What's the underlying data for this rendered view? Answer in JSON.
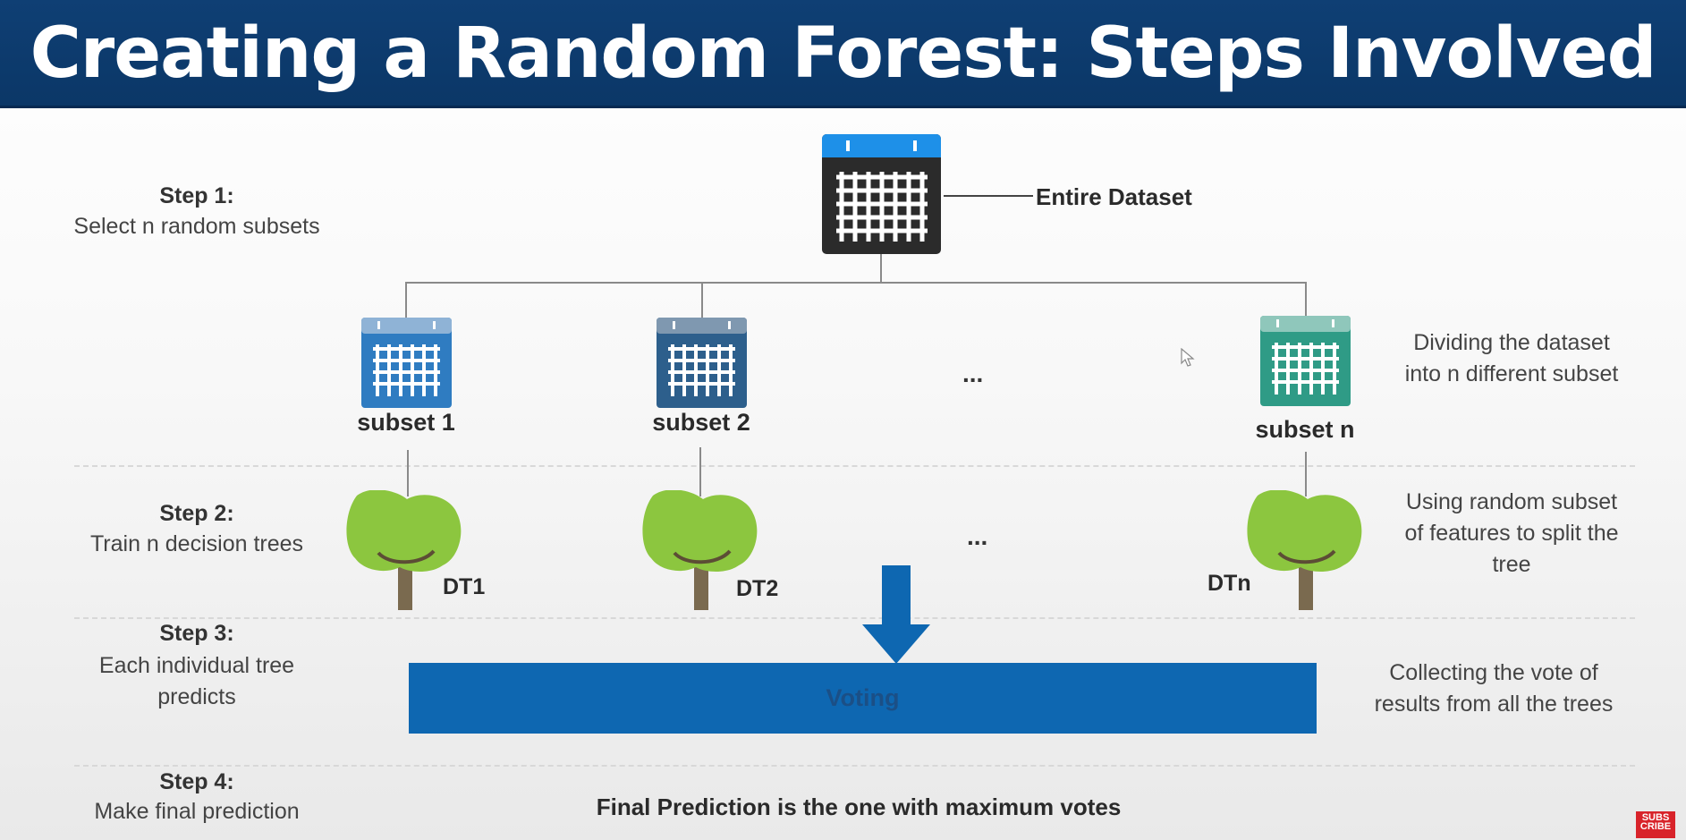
{
  "title": "Creating a Random Forest: Steps Involved",
  "steps": [
    {
      "title": "Step 1:",
      "desc": "Select n random subsets"
    },
    {
      "title": "Step 2:",
      "desc": "Train n decision trees"
    },
    {
      "title": "Step 3:",
      "desc": [
        "Each individual tree",
        "predicts"
      ]
    },
    {
      "title": "Step 4:",
      "desc": "Make final prediction"
    }
  ],
  "dataset_label": "Entire Dataset",
  "subsets": [
    "subset 1",
    "subset 2",
    "subset n"
  ],
  "trees": [
    "DT1",
    "DT2",
    "DTn"
  ],
  "ellipsis": "...",
  "notes": {
    "dividing": [
      "Dividing the dataset",
      "into n different subset"
    ],
    "features": [
      "Using random subset",
      "of features to split the",
      "tree"
    ],
    "collecting": [
      "Collecting the vote of",
      "results from all the trees"
    ]
  },
  "voting_label": "Voting",
  "final_prediction": "Final Prediction is the one with maximum votes",
  "subscribe": [
    "SUBS",
    "CRIBE"
  ],
  "colors": {
    "header": "#0b3767",
    "voting_bar": "#0e67b1",
    "subset1": "#2f7cc1",
    "subset2": "#2d5f8c",
    "subsetn": "#2f9b86",
    "tree_green": "#8cc63f",
    "trunk": "#7a6a4f"
  }
}
